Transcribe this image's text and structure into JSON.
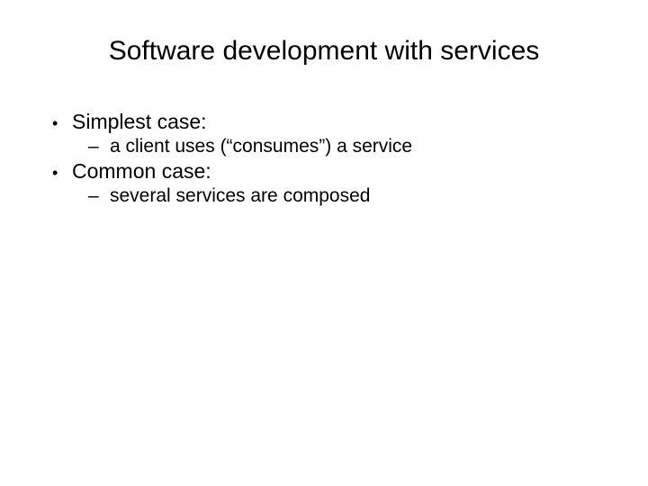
{
  "slide": {
    "title": "Software development with services",
    "items": [
      {
        "text": "Simplest case:",
        "sub": [
          " a client uses (“consumes”) a service"
        ]
      },
      {
        "text": "Common case:",
        "sub": [
          "several services are composed"
        ]
      }
    ]
  }
}
